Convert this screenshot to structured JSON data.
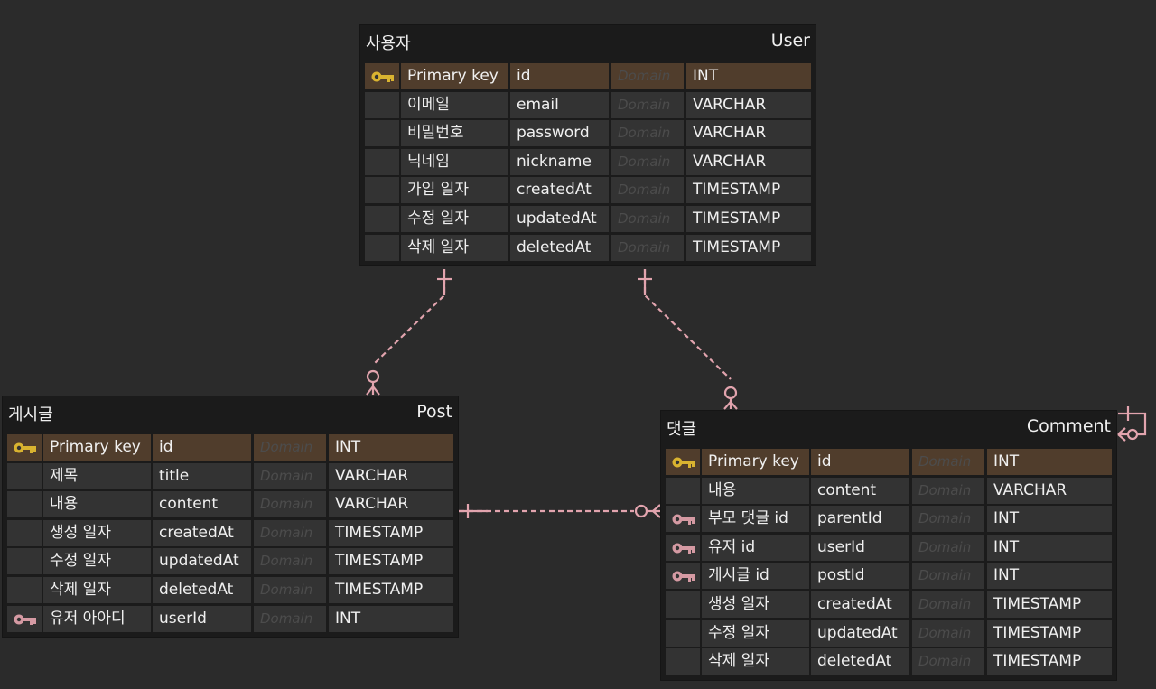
{
  "colors": {
    "background": "#2b2b2b",
    "entity_bg": "#1b1b1b",
    "cell_bg": "#333333",
    "pk_row_bg": "#503d2c",
    "primary_key_icon": "#d9b330",
    "foreign_key_icon": "#d59aa3",
    "relation_line": "#e2a4ae",
    "domain_placeholder": "#4c4c4c"
  },
  "entities": [
    {
      "id": "user",
      "logical_name": "사용자",
      "physical_name": "User",
      "columns": [
        {
          "key": "primary-key-icon",
          "logical": "Primary key",
          "physical": "id",
          "domain": "Domain",
          "type": "INT"
        },
        {
          "key": "",
          "logical": "이메일",
          "physical": "email",
          "domain": "Domain",
          "type": "VARCHAR"
        },
        {
          "key": "",
          "logical": "비밀번호",
          "physical": "password",
          "domain": "Domain",
          "type": "VARCHAR"
        },
        {
          "key": "",
          "logical": "닉네임",
          "physical": "nickname",
          "domain": "Domain",
          "type": "VARCHAR"
        },
        {
          "key": "",
          "logical": "가입 일자",
          "physical": "createdAt",
          "domain": "Domain",
          "type": "TIMESTAMP"
        },
        {
          "key": "",
          "logical": "수정 일자",
          "physical": "updatedAt",
          "domain": "Domain",
          "type": "TIMESTAMP"
        },
        {
          "key": "",
          "logical": "삭제 일자",
          "physical": "deletedAt",
          "domain": "Domain",
          "type": "TIMESTAMP"
        }
      ]
    },
    {
      "id": "post",
      "logical_name": "게시글",
      "physical_name": "Post",
      "columns": [
        {
          "key": "primary-key-icon",
          "logical": "Primary key",
          "physical": "id",
          "domain": "Domain",
          "type": "INT"
        },
        {
          "key": "",
          "logical": "제목",
          "physical": "title",
          "domain": "Domain",
          "type": "VARCHAR"
        },
        {
          "key": "",
          "logical": "내용",
          "physical": "content",
          "domain": "Domain",
          "type": "VARCHAR"
        },
        {
          "key": "",
          "logical": "생성 일자",
          "physical": "createdAt",
          "domain": "Domain",
          "type": "TIMESTAMP"
        },
        {
          "key": "",
          "logical": "수정 일자",
          "physical": "updatedAt",
          "domain": "Domain",
          "type": "TIMESTAMP"
        },
        {
          "key": "",
          "logical": "삭제 일자",
          "physical": "deletedAt",
          "domain": "Domain",
          "type": "TIMESTAMP"
        },
        {
          "key": "foreign-key-icon",
          "logical": "유저 아아디",
          "physical": "userId",
          "domain": "Domain",
          "type": "INT"
        }
      ]
    },
    {
      "id": "comment",
      "logical_name": "댓글",
      "physical_name": "Comment",
      "columns": [
        {
          "key": "primary-key-icon",
          "logical": "Primary key",
          "physical": "id",
          "domain": "Domain",
          "type": "INT"
        },
        {
          "key": "",
          "logical": "내용",
          "physical": "content",
          "domain": "Domain",
          "type": "VARCHAR"
        },
        {
          "key": "foreign-key-icon",
          "logical": "부모 댓글 id",
          "physical": "parentId",
          "domain": "Domain",
          "type": "INT"
        },
        {
          "key": "foreign-key-icon",
          "logical": "유저 id",
          "physical": "userId",
          "domain": "Domain",
          "type": "INT"
        },
        {
          "key": "foreign-key-icon",
          "logical": "게시글 id",
          "physical": "postId",
          "domain": "Domain",
          "type": "INT"
        },
        {
          "key": "",
          "logical": "생성 일자",
          "physical": "createdAt",
          "domain": "Domain",
          "type": "TIMESTAMP"
        },
        {
          "key": "",
          "logical": "수정 일자",
          "physical": "updatedAt",
          "domain": "Domain",
          "type": "TIMESTAMP"
        },
        {
          "key": "",
          "logical": "삭제 일자",
          "physical": "deletedAt",
          "domain": "Domain",
          "type": "TIMESTAMP"
        }
      ]
    }
  ],
  "relationships": [
    {
      "from": "user",
      "to": "post",
      "from_end": "one-and-only-one",
      "to_end": "zero-or-many"
    },
    {
      "from": "user",
      "to": "comment",
      "from_end": "one-and-only-one",
      "to_end": "zero-or-many"
    },
    {
      "from": "post",
      "to": "comment",
      "from_end": "one-and-only-one",
      "to_end": "zero-or-many"
    },
    {
      "from": "comment",
      "to": "comment",
      "from_end": "one-and-only-one",
      "to_end": "zero-or-many"
    }
  ]
}
